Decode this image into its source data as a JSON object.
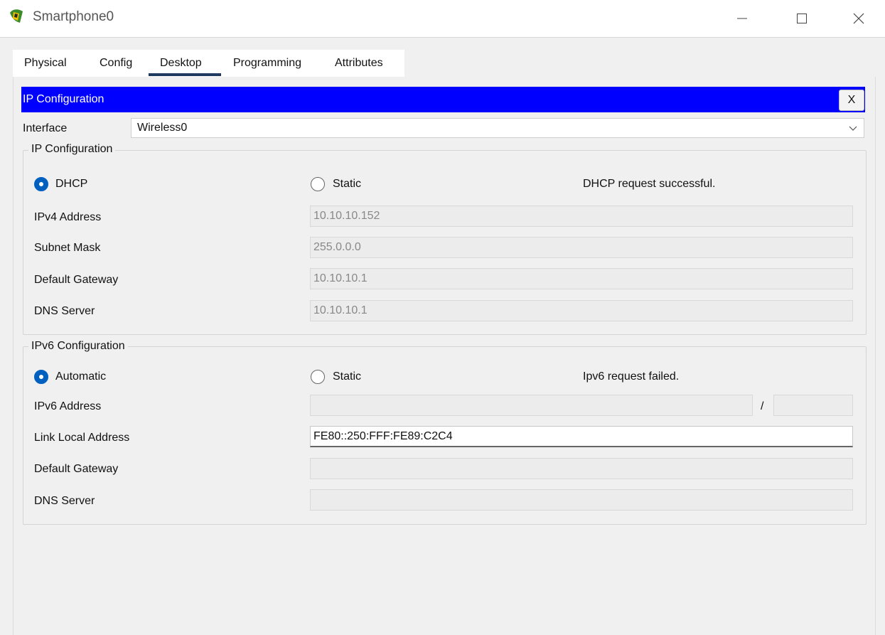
{
  "window": {
    "title": "Smartphone0"
  },
  "tabs": [
    "Physical",
    "Config",
    "Desktop",
    "Programming",
    "Attributes"
  ],
  "active_tab": "Desktop",
  "panel": {
    "title": "IP Configuration",
    "close_label": "X"
  },
  "interface": {
    "label": "Interface",
    "value": "Wireless0"
  },
  "ipv4": {
    "group_title": "IP Configuration",
    "dhcp_label": "DHCP",
    "static_label": "Static",
    "status": "DHCP request successful.",
    "fields": [
      {
        "label": "IPv4 Address",
        "value": "10.10.10.152"
      },
      {
        "label": "Subnet Mask",
        "value": "255.0.0.0"
      },
      {
        "label": "Default Gateway",
        "value": "10.10.10.1"
      },
      {
        "label": "DNS Server",
        "value": "10.10.10.1"
      }
    ]
  },
  "ipv6": {
    "group_title": "IPv6 Configuration",
    "automatic_label": "Automatic",
    "static_label": "Static",
    "status": "Ipv6 request failed.",
    "prefix_separator": "/",
    "fields": [
      {
        "label": "IPv6 Address",
        "value": "",
        "prefix": ""
      },
      {
        "label": "Link Local Address",
        "value": "FE80::250:FFF:FE89:C2C4"
      },
      {
        "label": "Default Gateway",
        "value": ""
      },
      {
        "label": "DNS Server",
        "value": ""
      }
    ]
  },
  "colors": {
    "panel_header": "#0000ff",
    "radio_selected": "#0060c0",
    "active_tab_underline": "#1f3a5f"
  }
}
